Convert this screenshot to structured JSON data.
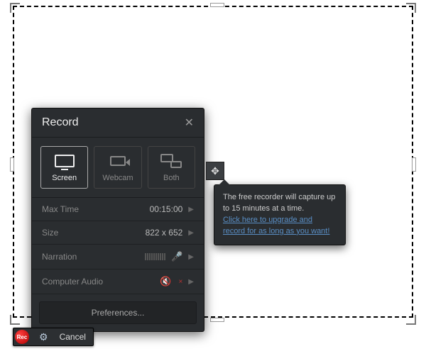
{
  "panel": {
    "title": "Record",
    "modes": {
      "screen": "Screen",
      "webcam": "Webcam",
      "both": "Both"
    },
    "settings": {
      "maxtime": {
        "label": "Max Time",
        "value": "00:15:00"
      },
      "size": {
        "label": "Size",
        "value": "822 x 652"
      },
      "narration": {
        "label": "Narration"
      },
      "audio": {
        "label": "Computer Audio"
      }
    },
    "prefs": "Preferences..."
  },
  "tooltip": {
    "text": "The free recorder will capture up to 15 minutes at a time.",
    "link": "Click here to upgrade and record for as long as you want!"
  },
  "toolbar": {
    "rec": "Rec",
    "cancel": "Cancel"
  }
}
